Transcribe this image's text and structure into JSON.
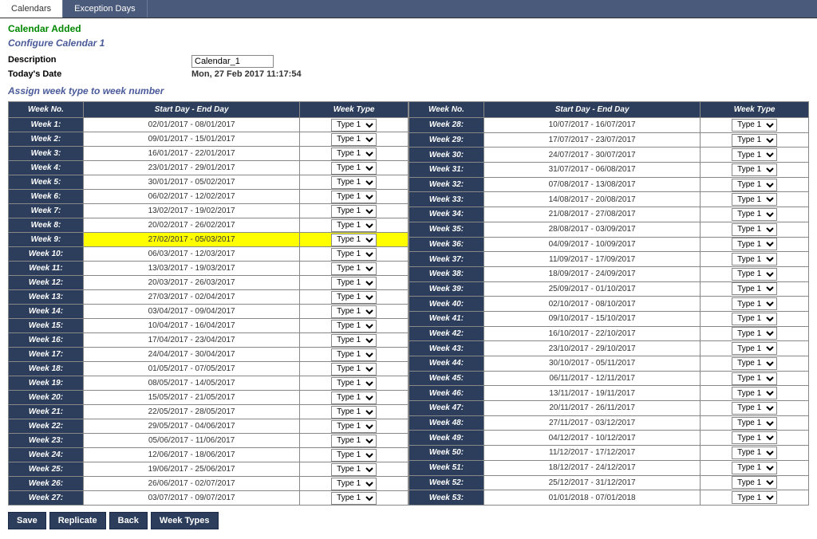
{
  "tabs": {
    "calendars": "Calendars",
    "exception": "Exception Days"
  },
  "status": "Calendar Added",
  "subtitle": "Configure Calendar 1",
  "desc_label": "Description",
  "desc_value": "Calendar_1",
  "date_label": "Today's Date",
  "date_value": "Mon, 27 Feb 2017 11:17:54",
  "section": "Assign week type to week number",
  "headers": {
    "weekno": "Week No.",
    "range": "Start Day - End Day",
    "type": "Week Type"
  },
  "type_option": "Type 1",
  "buttons": {
    "save": "Save",
    "replicate": "Replicate",
    "back": "Back",
    "weektypes": "Week Types"
  },
  "left": [
    {
      "n": "Week 1:",
      "r": "02/01/2017 - 08/01/2017"
    },
    {
      "n": "Week 2:",
      "r": "09/01/2017 - 15/01/2017"
    },
    {
      "n": "Week 3:",
      "r": "16/01/2017 - 22/01/2017"
    },
    {
      "n": "Week 4:",
      "r": "23/01/2017 - 29/01/2017"
    },
    {
      "n": "Week 5:",
      "r": "30/01/2017 - 05/02/2017"
    },
    {
      "n": "Week 6:",
      "r": "06/02/2017 - 12/02/2017"
    },
    {
      "n": "Week 7:",
      "r": "13/02/2017 - 19/02/2017"
    },
    {
      "n": "Week 8:",
      "r": "20/02/2017 - 26/02/2017"
    },
    {
      "n": "Week 9:",
      "r": "27/02/2017 - 05/03/2017",
      "hl": true
    },
    {
      "n": "Week 10:",
      "r": "06/03/2017 - 12/03/2017"
    },
    {
      "n": "Week 11:",
      "r": "13/03/2017 - 19/03/2017"
    },
    {
      "n": "Week 12:",
      "r": "20/03/2017 - 26/03/2017"
    },
    {
      "n": "Week 13:",
      "r": "27/03/2017 - 02/04/2017"
    },
    {
      "n": "Week 14:",
      "r": "03/04/2017 - 09/04/2017"
    },
    {
      "n": "Week 15:",
      "r": "10/04/2017 - 16/04/2017"
    },
    {
      "n": "Week 16:",
      "r": "17/04/2017 - 23/04/2017"
    },
    {
      "n": "Week 17:",
      "r": "24/04/2017 - 30/04/2017"
    },
    {
      "n": "Week 18:",
      "r": "01/05/2017 - 07/05/2017"
    },
    {
      "n": "Week 19:",
      "r": "08/05/2017 - 14/05/2017"
    },
    {
      "n": "Week 20:",
      "r": "15/05/2017 - 21/05/2017"
    },
    {
      "n": "Week 21:",
      "r": "22/05/2017 - 28/05/2017"
    },
    {
      "n": "Week 22:",
      "r": "29/05/2017 - 04/06/2017"
    },
    {
      "n": "Week 23:",
      "r": "05/06/2017 - 11/06/2017"
    },
    {
      "n": "Week 24:",
      "r": "12/06/2017 - 18/06/2017"
    },
    {
      "n": "Week 25:",
      "r": "19/06/2017 - 25/06/2017"
    },
    {
      "n": "Week 26:",
      "r": "26/06/2017 - 02/07/2017"
    },
    {
      "n": "Week 27:",
      "r": "03/07/2017 - 09/07/2017"
    }
  ],
  "right": [
    {
      "n": "Week 28:",
      "r": "10/07/2017 - 16/07/2017"
    },
    {
      "n": "Week 29:",
      "r": "17/07/2017 - 23/07/2017"
    },
    {
      "n": "Week 30:",
      "r": "24/07/2017 - 30/07/2017"
    },
    {
      "n": "Week 31:",
      "r": "31/07/2017 - 06/08/2017"
    },
    {
      "n": "Week 32:",
      "r": "07/08/2017 - 13/08/2017"
    },
    {
      "n": "Week 33:",
      "r": "14/08/2017 - 20/08/2017"
    },
    {
      "n": "Week 34:",
      "r": "21/08/2017 - 27/08/2017"
    },
    {
      "n": "Week 35:",
      "r": "28/08/2017 - 03/09/2017"
    },
    {
      "n": "Week 36:",
      "r": "04/09/2017 - 10/09/2017"
    },
    {
      "n": "Week 37:",
      "r": "11/09/2017 - 17/09/2017"
    },
    {
      "n": "Week 38:",
      "r": "18/09/2017 - 24/09/2017"
    },
    {
      "n": "Week 39:",
      "r": "25/09/2017 - 01/10/2017"
    },
    {
      "n": "Week 40:",
      "r": "02/10/2017 - 08/10/2017"
    },
    {
      "n": "Week 41:",
      "r": "09/10/2017 - 15/10/2017"
    },
    {
      "n": "Week 42:",
      "r": "16/10/2017 - 22/10/2017"
    },
    {
      "n": "Week 43:",
      "r": "23/10/2017 - 29/10/2017"
    },
    {
      "n": "Week 44:",
      "r": "30/10/2017 - 05/11/2017"
    },
    {
      "n": "Week 45:",
      "r": "06/11/2017 - 12/11/2017"
    },
    {
      "n": "Week 46:",
      "r": "13/11/2017 - 19/11/2017"
    },
    {
      "n": "Week 47:",
      "r": "20/11/2017 - 26/11/2017"
    },
    {
      "n": "Week 48:",
      "r": "27/11/2017 - 03/12/2017"
    },
    {
      "n": "Week 49:",
      "r": "04/12/2017 - 10/12/2017"
    },
    {
      "n": "Week 50:",
      "r": "11/12/2017 - 17/12/2017"
    },
    {
      "n": "Week 51:",
      "r": "18/12/2017 - 24/12/2017"
    },
    {
      "n": "Week 52:",
      "r": "25/12/2017 - 31/12/2017"
    },
    {
      "n": "Week 53:",
      "r": "01/01/2018 - 07/01/2018"
    }
  ]
}
